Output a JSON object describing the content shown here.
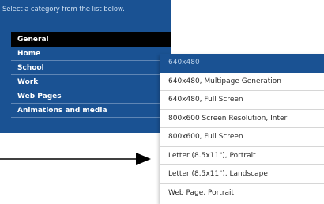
{
  "panel": {
    "prompt": "Select a category from the list below.",
    "categories": [
      {
        "label": "General"
      },
      {
        "label": "Home"
      },
      {
        "label": "School"
      },
      {
        "label": "Work"
      },
      {
        "label": "Web Pages"
      },
      {
        "label": "Animations and media"
      }
    ],
    "selected_category": "General"
  },
  "dropdown": {
    "items": [
      {
        "label": "640x480"
      },
      {
        "label": "640x480, Multipage Generation"
      },
      {
        "label": "640x480, Full Screen"
      },
      {
        "label": "800x600 Screen Resolution, Inter"
      },
      {
        "label": "800x600, Full Screen"
      },
      {
        "label": "Letter (8.5x11\"), Portrait"
      },
      {
        "label": "Letter (8.5x11\"), Landscape"
      },
      {
        "label": "Web Page, Portrait"
      }
    ],
    "selected_item": "640x480"
  },
  "colors": {
    "panel_bg": "#1a5293",
    "selected_category_bg": "#000000",
    "selected_item_bg": "#1a5293",
    "arrow": "#000000"
  },
  "icons": {
    "pointer": "arrow-right-icon"
  }
}
